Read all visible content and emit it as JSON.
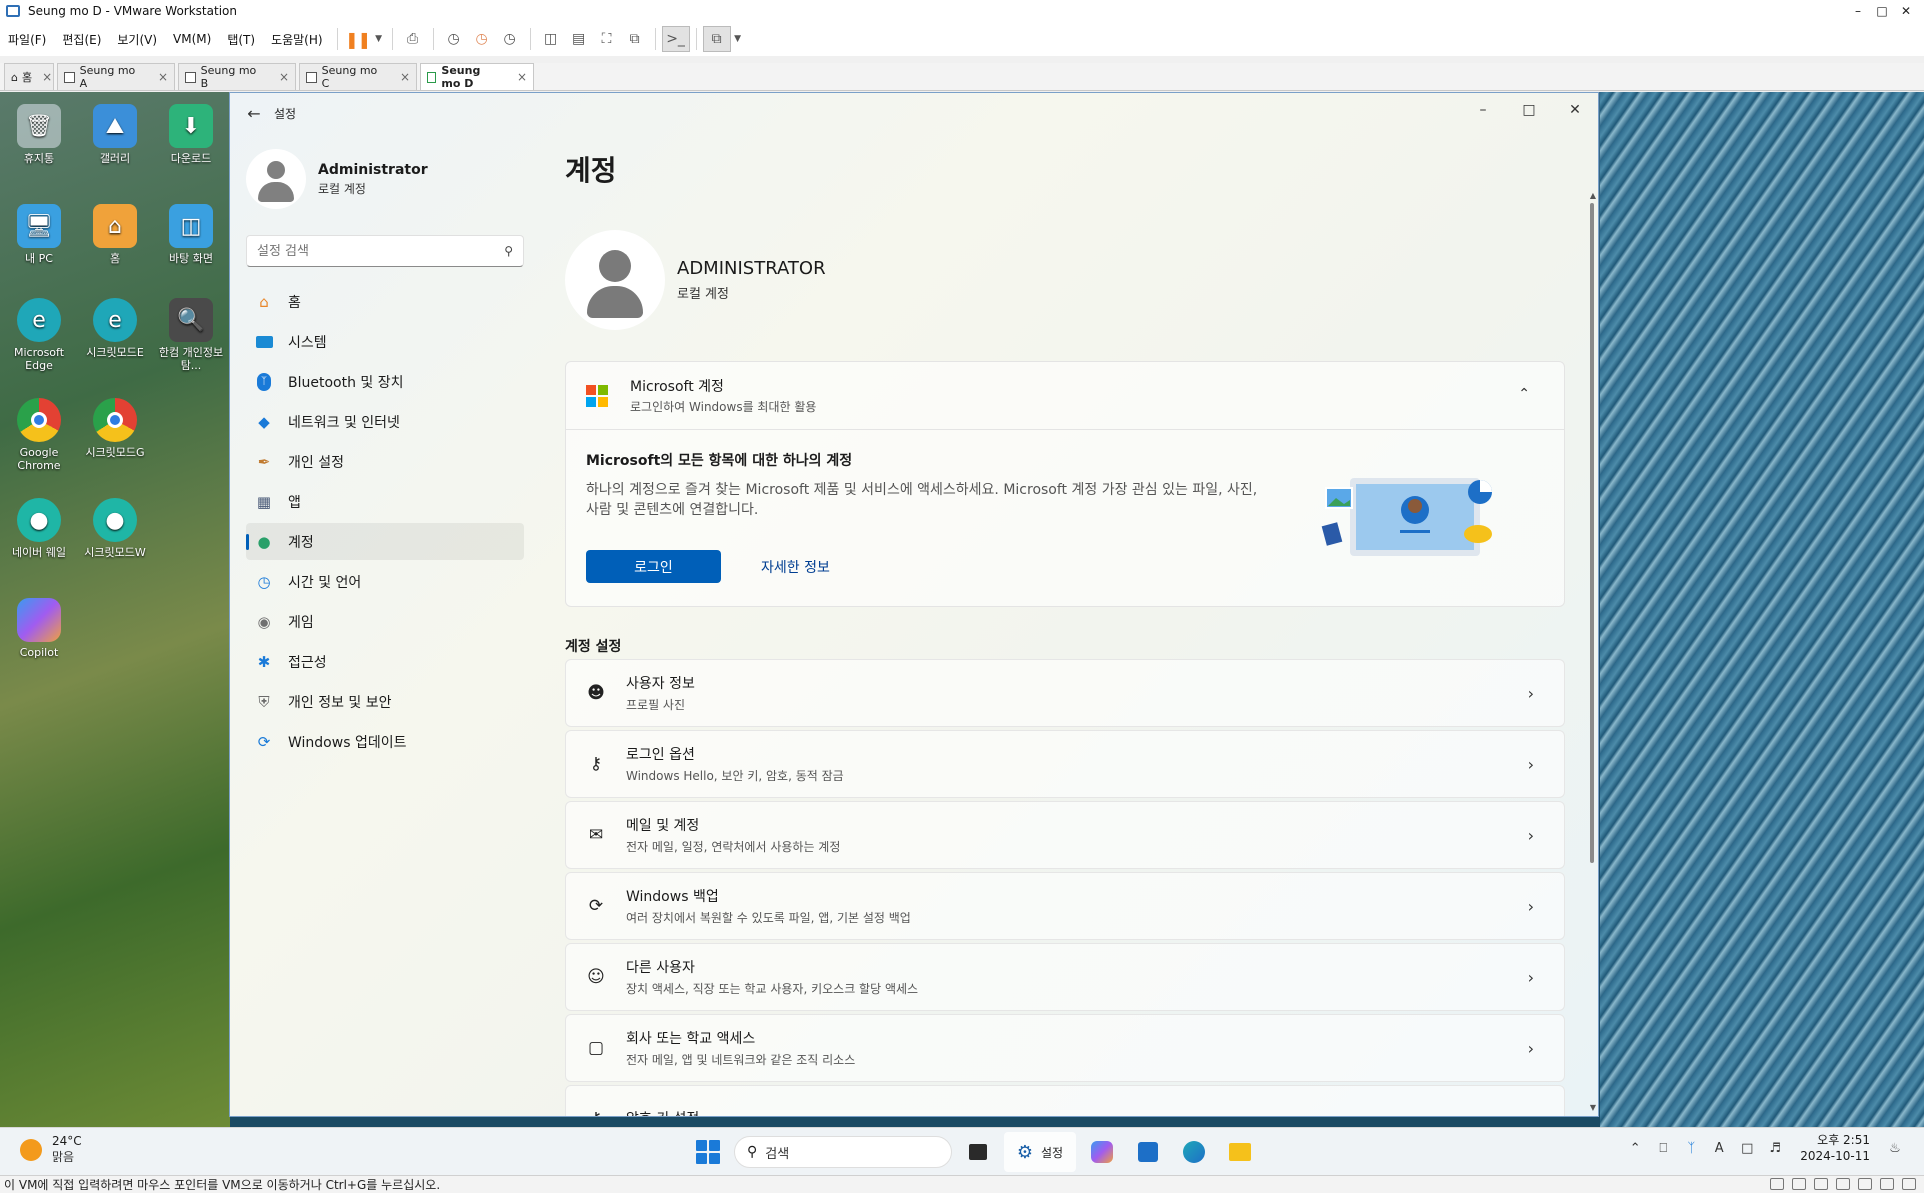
{
  "vm": {
    "window_title": "Seung mo D - VMware Workstation",
    "menus": [
      "파일(F)",
      "편집(E)",
      "보기(V)",
      "VM(M)",
      "탭(T)",
      "도움말(H)"
    ],
    "tabs": [
      {
        "label": "홈",
        "icon": "home-icon"
      },
      {
        "label": "Seung mo A",
        "icon": "vm-icon"
      },
      {
        "label": "Seung mo B",
        "icon": "vm-icon"
      },
      {
        "label": "Seung mo C",
        "icon": "vm-icon"
      },
      {
        "label": "Seung mo D",
        "icon": "vm-play-icon",
        "active": true
      }
    ],
    "status_text": "이 VM에 직접 입력하려면 마우스 포인터를 VM으로 이동하거나 Ctrl+G를 누르십시오."
  },
  "desktop": {
    "icons": [
      {
        "label": "휴지통",
        "icon": "recycle-bin-icon",
        "color": "#c9d3db"
      },
      {
        "label": "갤러리",
        "icon": "gallery-icon",
        "color": "#3b8fd9"
      },
      {
        "label": "다운로드",
        "icon": "download-folder-icon",
        "color": "#2db37a"
      },
      {
        "label": "내 PC",
        "icon": "computer-icon",
        "color": "#3aa0e0"
      },
      {
        "label": "홈",
        "icon": "home-icon",
        "color": "#f0a23a"
      },
      {
        "label": "바탕 화면",
        "icon": "desktop-folder-icon",
        "color": "#3aa0e0"
      },
      {
        "label": "Microsoft Edge",
        "icon": "edge-icon",
        "color": "#1fa7b8"
      },
      {
        "label": "시크릿모드E",
        "icon": "edge-icon",
        "color": "#1fa7b8"
      },
      {
        "label": "한컴 개인정보탐...",
        "icon": "magnifier-icon",
        "color": "#4a4a4a"
      },
      {
        "label": "Google Chrome",
        "icon": "chrome-icon",
        "color": "#e34133"
      },
      {
        "label": "시크릿모드G",
        "icon": "chrome-icon",
        "color": "#e34133"
      },
      {
        "label": "네이버 웨일",
        "icon": "whale-icon",
        "color": "#1fb6a6"
      },
      {
        "label": "시크릿모드W",
        "icon": "whale-icon",
        "color": "#1fb6a6"
      },
      {
        "label": "Copilot",
        "icon": "copilot-icon",
        "color": "#7a5cf0"
      }
    ]
  },
  "settings": {
    "app_title": "설정",
    "user": {
      "name": "Administrator",
      "subtitle": "로컬 계정"
    },
    "search_placeholder": "설정 검색",
    "nav": [
      {
        "label": "홈",
        "icon": "home-icon",
        "color": "#e8862b"
      },
      {
        "label": "시스템",
        "icon": "monitor-icon",
        "color": "#1a8ad4"
      },
      {
        "label": "Bluetooth 및 장치",
        "icon": "bluetooth-icon",
        "color": "#1a7ad8"
      },
      {
        "label": "네트워크 및 인터넷",
        "icon": "wifi-icon",
        "color": "#1a7ad8"
      },
      {
        "label": "개인 설정",
        "icon": "brush-icon",
        "color": "#c07a30"
      },
      {
        "label": "앱",
        "icon": "apps-icon",
        "color": "#4a5a78"
      },
      {
        "label": "계정",
        "icon": "person-icon",
        "color": "#2aa06a",
        "active": true
      },
      {
        "label": "시간 및 언어",
        "icon": "clock-globe-icon",
        "color": "#1a7ad8"
      },
      {
        "label": "게임",
        "icon": "gamepad-icon",
        "color": "#707070"
      },
      {
        "label": "접근성",
        "icon": "accessibility-icon",
        "color": "#1a7ad8"
      },
      {
        "label": "개인 정보 및 보안",
        "icon": "shield-icon",
        "color": "#6a6a6a"
      },
      {
        "label": "Windows 업데이트",
        "icon": "update-icon",
        "color": "#1a7ad8"
      }
    ],
    "page_title": "계정",
    "account": {
      "name": "ADMINISTRATOR",
      "type": "로컬 계정"
    },
    "ms_card": {
      "title": "Microsoft 계정",
      "subtitle": "로그인하여 Windows를 최대한 활용",
      "body_title": "Microsoft의 모든 항목에 대한 하나의 계정",
      "body_desc": "하나의 계정으로 즐겨 찾는 Microsoft 제품 및 서비스에 액세스하세요. Microsoft 계정 가장 관심 있는 파일, 사진, 사람 및 콘텐츠에 연결합니다.",
      "login_label": "로그인",
      "more_label": "자세한 정보"
    },
    "section_title": "계정 설정",
    "rows": [
      {
        "title": "사용자 정보",
        "subtitle": "프로필 사진",
        "icon": "user-info-icon"
      },
      {
        "title": "로그인 옵션",
        "subtitle": "Windows Hello, 보안 키, 암호, 동적 잠금",
        "icon": "key-icon"
      },
      {
        "title": "메일 및 계정",
        "subtitle": "전자 메일, 일정, 연락처에서 사용하는 계정",
        "icon": "mail-icon"
      },
      {
        "title": "Windows 백업",
        "subtitle": "여러 장치에서 복원할 수 있도록 파일, 앱, 기본 설정 백업",
        "icon": "backup-icon"
      },
      {
        "title": "다른 사용자",
        "subtitle": "장치 액세스, 직장 또는 학교 사용자, 키오스크 할당 액세스",
        "icon": "add-user-icon"
      },
      {
        "title": "회사 또는 학교 액세스",
        "subtitle": "전자 메일, 앱 및 네트워크와 같은 조직 리소스",
        "icon": "briefcase-icon"
      },
      {
        "title": "암호 키 설정",
        "subtitle": "",
        "icon": "passkey-icon"
      }
    ]
  },
  "taskbar": {
    "weather_temp": "24°C",
    "weather_desc": "맑음",
    "search_label": "검색",
    "active_app_label": "설정",
    "time": "오후 2:51",
    "date": "2024-10-11"
  }
}
